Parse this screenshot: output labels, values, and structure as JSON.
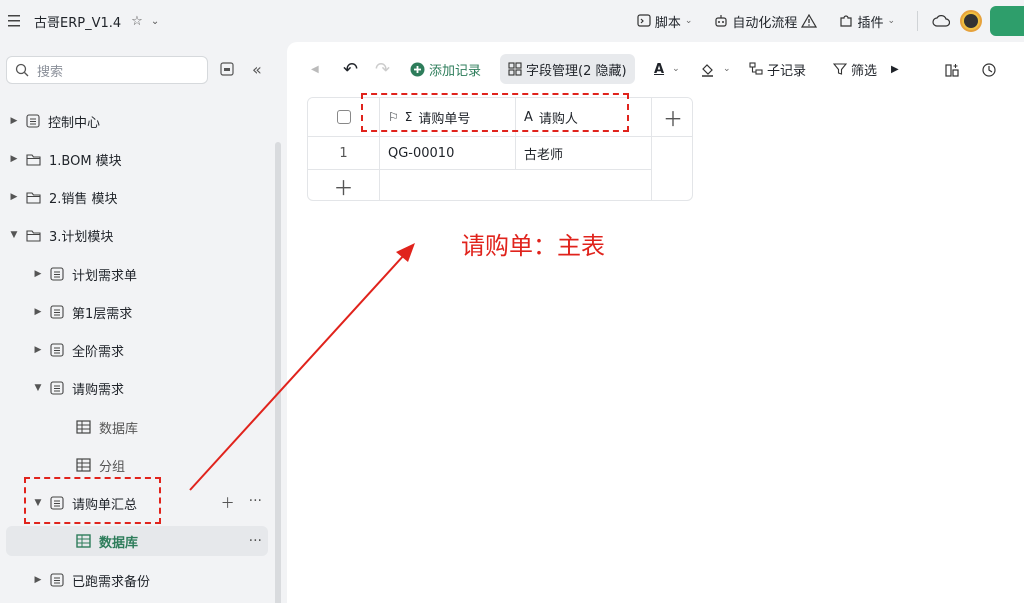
{
  "app": {
    "title": "古哥ERP_V1.4"
  },
  "topbar": {
    "script_label": "脚本",
    "automation_label": "自动化流程",
    "plugin_label": "插件"
  },
  "sidebar": {
    "search_placeholder": "搜索",
    "items": [
      {
        "label": "控制中心"
      },
      {
        "label": "1.BOM 模块"
      },
      {
        "label": "2.销售 模块"
      },
      {
        "label": "3.计划模块"
      },
      {
        "label": "计划需求单"
      },
      {
        "label": "第1层需求"
      },
      {
        "label": "全阶需求"
      },
      {
        "label": "请购需求"
      },
      {
        "label": "数据库"
      },
      {
        "label": "分组"
      },
      {
        "label": "请购单汇总"
      },
      {
        "label": "数据库"
      },
      {
        "label": "已跑需求备份"
      }
    ]
  },
  "toolbar": {
    "add_record": "添加记录",
    "field_manage": "字段管理(2 隐藏)",
    "sub_record": "子记录",
    "filter": "筛选"
  },
  "table": {
    "columns": [
      "请购单号",
      "请购人"
    ],
    "rows": [
      {
        "index": "1",
        "cells": [
          "QG-00010",
          "古老师"
        ]
      }
    ]
  },
  "annotation": {
    "text": "请购单：主表",
    "color": "#e0231c"
  },
  "colors": {
    "accent": "#2e7d5b",
    "brand_green": "#2e9e6b"
  }
}
